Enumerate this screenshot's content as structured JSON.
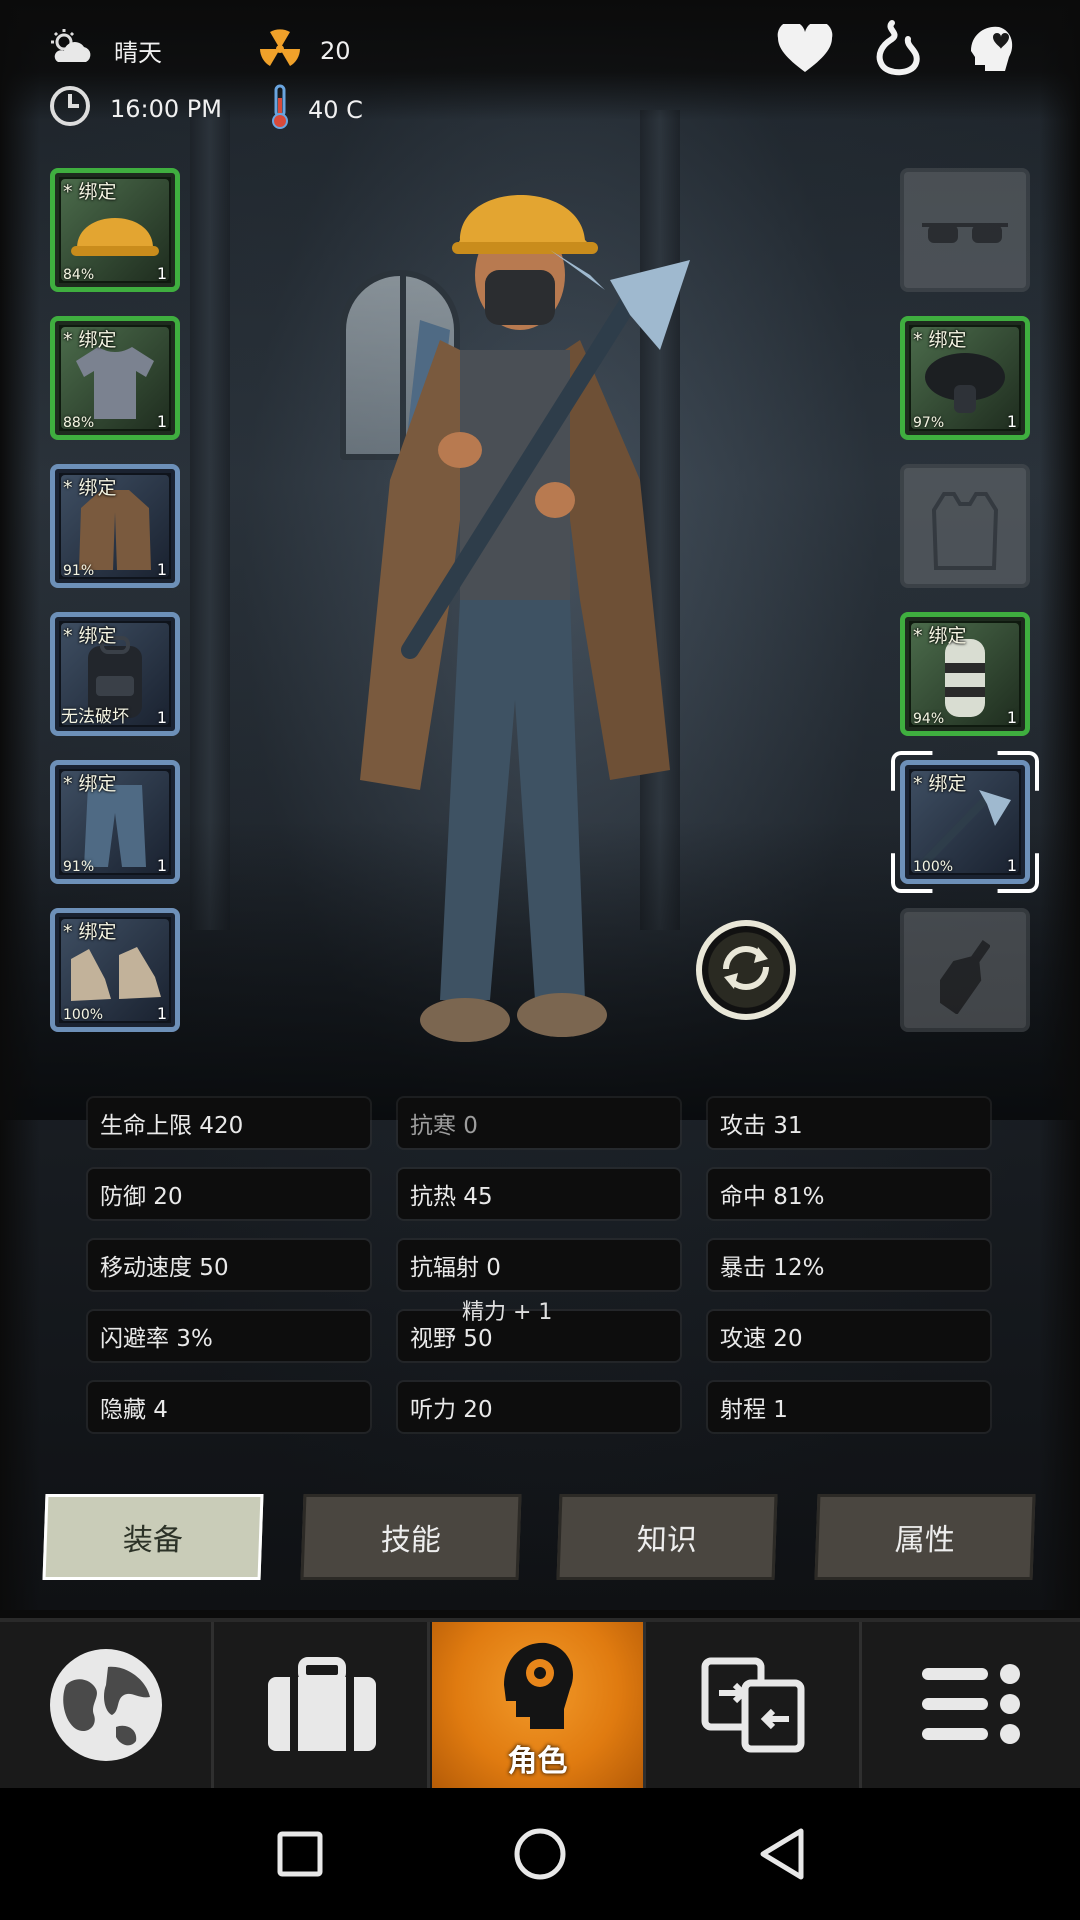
{
  "status": {
    "weather": "晴天",
    "radiation": "20",
    "time": "16:00 PM",
    "temperature": "40 C"
  },
  "top_icons": [
    "heart-icon",
    "stomach-icon",
    "mind-icon"
  ],
  "equipment_left": [
    {
      "tag": "* 绑定",
      "durability": "84%",
      "count": "1",
      "frame": "green",
      "item": "hard-hat"
    },
    {
      "tag": "* 绑定",
      "durability": "88%",
      "count": "1",
      "frame": "green",
      "item": "tshirt"
    },
    {
      "tag": "* 绑定",
      "durability": "91%",
      "count": "1",
      "frame": "blue",
      "item": "coat"
    },
    {
      "tag": "* 绑定",
      "durability": "",
      "note": "无法破坏",
      "count": "1",
      "frame": "blue",
      "item": "backpack"
    },
    {
      "tag": "* 绑定",
      "durability": "91%",
      "count": "1",
      "frame": "blue",
      "item": "jeans"
    },
    {
      "tag": "* 绑定",
      "durability": "100%",
      "count": "1",
      "frame": "blue",
      "item": "boots"
    }
  ],
  "equipment_right": [
    {
      "tag": "",
      "durability": "",
      "count": "",
      "frame": "empty",
      "item": "glasses"
    },
    {
      "tag": "* 绑定",
      "durability": "97%",
      "count": "1",
      "frame": "green",
      "item": "gas-mask"
    },
    {
      "tag": "",
      "durability": "",
      "count": "",
      "frame": "empty",
      "item": "vest"
    },
    {
      "tag": "* 绑定",
      "durability": "94%",
      "count": "1",
      "frame": "green",
      "item": "arm-guard"
    },
    {
      "tag": "* 绑定",
      "durability": "100%",
      "count": "1",
      "frame": "blue",
      "item": "ice-axe",
      "selected": true
    },
    {
      "tag": "",
      "durability": "",
      "count": "",
      "frame": "empty",
      "item": "molotov"
    }
  ],
  "stats": [
    [
      "生命上限 420",
      "抗寒 0",
      "攻击 31"
    ],
    [
      "防御 20",
      "抗热 45",
      "命中 81%"
    ],
    [
      "移动速度 50",
      "抗辐射 0",
      "暴击 12%"
    ],
    [
      "闪避率 3%",
      "视野 50",
      "攻速 20"
    ],
    [
      "隐藏 4",
      "听力 20",
      "射程 1"
    ]
  ],
  "float_text": "精力 + 1",
  "tabs": [
    "装备",
    "技能",
    "知识",
    "属性"
  ],
  "active_tab": 0,
  "nav": {
    "items": [
      "map-icon",
      "inventory-icon",
      "character-icon",
      "trade-icon",
      "menu-icon"
    ],
    "active_label": "角色"
  },
  "colors": {
    "accent_orange": "#e07b10",
    "frame_green": "#3fae3f",
    "frame_blue": "#6d90b8",
    "active_tab": "#c9ccb8"
  }
}
